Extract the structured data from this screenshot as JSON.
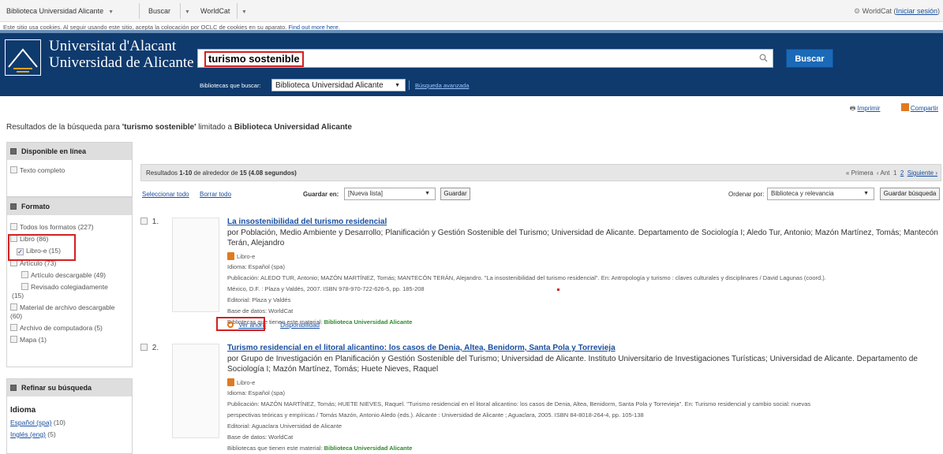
{
  "topnav": {
    "library": "Biblioteca Universidad Alicante",
    "buscar": "Buscar",
    "worldcat": "WorldCat",
    "right_prefix": "WorldCat (",
    "signin": "Iniciar sesión",
    "right_suffix": ")"
  },
  "cookie": {
    "text": "Este sitio usa cookies. Al seguir usando este sitio, acepta la colocación por OCLC de cookies en su aparato.",
    "link": "Find out more here."
  },
  "banner": {
    "name_line1": "Universitat d'Alacant",
    "name_line2": "Universidad de Alicante",
    "search_value": "turismo sostenible",
    "search_button": "Buscar",
    "libraries_label": "Bibliotecas que buscar:",
    "libraries_value": "Biblioteca Universidad Alicante",
    "advanced": "Búsqueda avanzada"
  },
  "tools": {
    "print": "Imprimir",
    "share": "Compartir"
  },
  "summary": {
    "prefix": "Resultados de la búsqueda para",
    "query": "'turismo sostenible'",
    "middle": "limitado a",
    "limit": "Biblioteca Universidad Alicante"
  },
  "sidebar": {
    "online": {
      "title": "Disponible en línea",
      "option": "Texto completo"
    },
    "format": {
      "title": "Formato",
      "all": "Todos los formatos (227)",
      "libro": "Libro (86)",
      "libro_e": "Libro-e (15)",
      "articulo": "Artículo (73)",
      "articulo_desc": "Artículo descargable (49)",
      "revisado_1": "Revisado colegiadamente",
      "revisado_2": "(15)",
      "material_1": "Material de archivo descargable",
      "material_2": "(60)",
      "archivo": "Archivo de computadora (5)",
      "mapa": "Mapa (1)"
    },
    "refine": {
      "title": "Refinar su búsqueda",
      "idioma": "Idioma",
      "espanol": "Español (spa)",
      "espanol_count": "(10)",
      "ingles": "Inglés (eng)",
      "ingles_count": "(5)"
    }
  },
  "results": {
    "count_prefix": "Resultados",
    "count_range": "1-10",
    "count_middle": "de alrededor de",
    "count_total": "15",
    "count_time": "(4.08 segundos)",
    "nav_first": "« Primera",
    "nav_prev": "‹ Ant",
    "nav_page1": "1",
    "nav_page2": "2",
    "nav_next": "Siguiente ›",
    "select_all": "Seleccionar todo",
    "clear_all": "Borrar todo",
    "save_in_label": "Guardar en:",
    "save_in_value": "[Nueva lista]",
    "save_button": "Guardar",
    "sort_label": "Ordenar por:",
    "sort_value": "Biblioteca y relevancia",
    "save_search": "Guardar búsqueda"
  },
  "records": [
    {
      "num": "1.",
      "title": "La insostenibilidad del turismo residencial",
      "authors": "por Población, Medio Ambiente y Desarrollo; Planificación y Gestión Sostenible del Turismo; Universidad de Alicante. Departamento de Sociología I; Aledo Tur, Antonio; Mazón Martínez, Tomás; Mantecón Terán, Alejandro",
      "format": "Libro-e",
      "language": "Idioma: Español (spa)",
      "publication_1": "Publicación: ALEDO TUR, Antonio; MAZÓN MARTÍNEZ, Tomás; MANTECÓN TERÁN, Alejandro. \"La insostenibilidad del turismo residencial\". En: Antropología y turismo : claves culturales y disciplinares / David Lagunas (coord.).",
      "publication_2": "México, D.F. : Plaza y Valdés, 2007. ISBN 978-970-722-626-5, pp. 185-208",
      "publisher": "Editorial: Plaza y Valdés",
      "database": "Base de datos: WorldCat",
      "holding_label": "Bibliotecas que tienen este material:",
      "holding_value": "Biblioteca Universidad Alicante",
      "view_now": "Ver ahora",
      "availability": "Disponibilidad"
    },
    {
      "num": "2.",
      "title": "Turismo residencial en el litoral alicantino: los casos de Denia, Altea, Benidorm, Santa Pola y Torrevieja",
      "authors": "por Grupo de Investigación en Planificación y Gestión Sostenible del Turismo; Universidad de Alicante. Instituto Universitario de Investigaciones Turísticas; Universidad de Alicante. Departamento de Sociología I; Mazón Martínez, Tomás; Huete Nieves, Raquel",
      "format": "Libro-e",
      "language": "Idioma: Español (spa)",
      "publication_1": "Publicación: MAZÓN MARTÍNEZ, Tomás; HUETE NIEVES, Raquel. \"Turismo residencial en el litoral alicantino: los casos de Denia, Altea, Benidorm, Santa Pola y Torrevieja\". En: Turismo residencial y cambio social: nuevas",
      "publication_2": "perspectivas teóricas y empíricas / Tomás Mazón, Antonio Aledo (eds.). Alicante : Universidad de Alicante ; Aguaclara, 2005. ISBN 84-8018-264-4, pp. 105-138",
      "publisher": "Editorial: Aguaclara Universidad de Alicante",
      "database": "Base de datos: WorldCat",
      "holding_label": "Bibliotecas que tienen este material:",
      "holding_value": "Biblioteca Universidad Alicante"
    }
  ],
  "colors": {
    "banner": "#0e3a6e",
    "link": "#1a4fa0",
    "highlight": "#d42020",
    "holding": "#2d8a2d"
  }
}
